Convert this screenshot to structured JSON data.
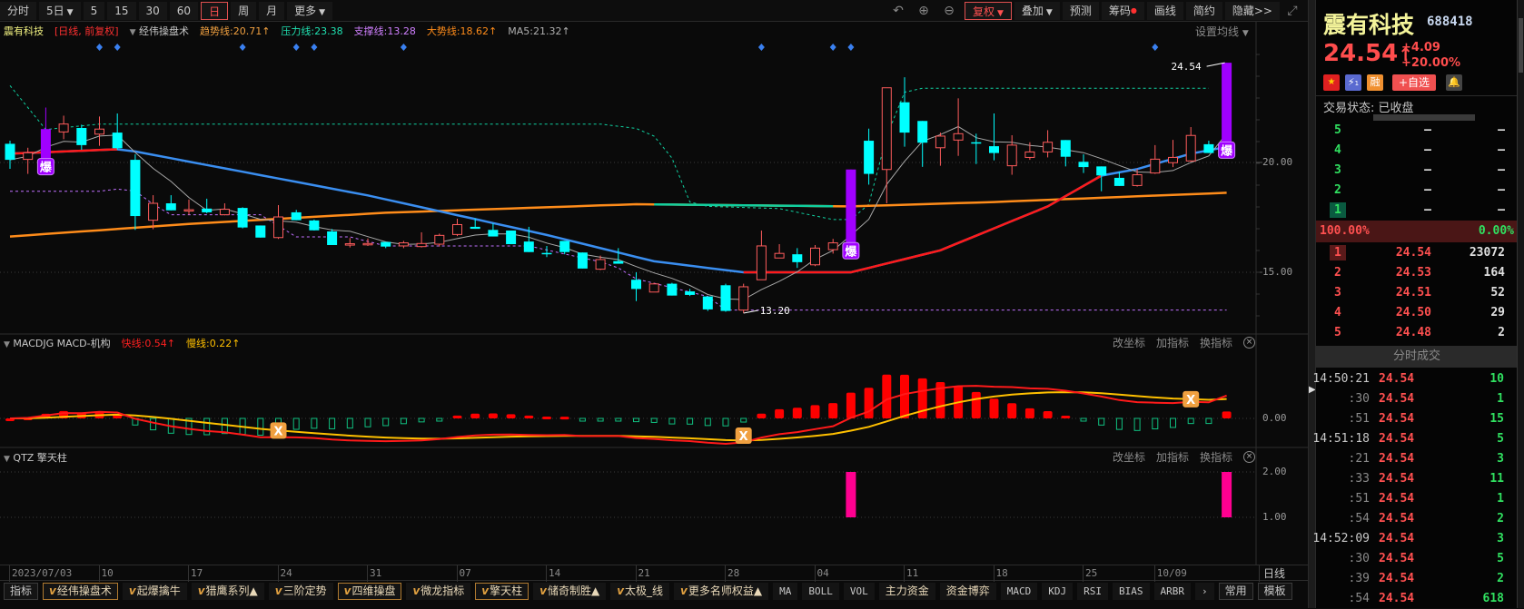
{
  "toolbar": {
    "left": [
      {
        "label": "分时"
      },
      {
        "label": "5日",
        "caret": true
      },
      {
        "label": "5"
      },
      {
        "label": "15"
      },
      {
        "label": "30"
      },
      {
        "label": "60"
      },
      {
        "label": "日",
        "selected": true
      },
      {
        "label": "周"
      },
      {
        "label": "月"
      },
      {
        "label": "更多",
        "caret": true
      }
    ],
    "icons": [
      "undo-icon",
      "zoom-in-icon",
      "zoom-out-icon"
    ],
    "icon_glyphs": [
      "↶",
      "⊕",
      "⊖"
    ],
    "right": [
      {
        "label": "复权",
        "caret": true,
        "selected": true
      },
      {
        "label": "叠加",
        "caret": true
      },
      {
        "label": "预测"
      },
      {
        "label": "筹码",
        "dot": true
      },
      {
        "label": "画线"
      },
      {
        "label": "简约"
      },
      {
        "label": "隐藏>>"
      }
    ],
    "fullscreen_glyph": "⤢"
  },
  "info": {
    "stock": "震有科技",
    "mode": "[日线, 前复权]",
    "indicator": "经伟操盘术",
    "trend": "趋势线:20.71↑",
    "pressure": "压力线:23.38",
    "support": "支撑线:13.28",
    "big_trend": "大势线:18.62↑",
    "ma5": "MA5:21.32↑",
    "set_ma": "设置均线"
  },
  "colors": {
    "up": "#ff5c5c",
    "down": "#00ffff",
    "explode": "#a000ff",
    "trend_up": "#ff1a1a",
    "trend_down": "#3a8ef0",
    "big_trend": "#ff8c1a",
    "big_trend_alt": "#10d0a0",
    "pressure": "#10d0a0",
    "support": "#c070ff",
    "ma5": "#a8a8a8",
    "diamond": "#3a80f0",
    "macd_fast": "#ff1a1a",
    "macd_slow": "#ffc000",
    "macd_pos": "#ff0000",
    "macd_neg": "#10c080",
    "qtz": "#ff0090"
  },
  "main_axis": {
    "ticks": [
      {
        "value": 20,
        "label": "20.00"
      },
      {
        "value": 15,
        "label": "15.00"
      }
    ]
  },
  "price_labels": {
    "high": "24.54",
    "low": "13.20",
    "explode": "爆"
  },
  "chart_data": {
    "type": "candlestick",
    "candles": [
      [
        20.85,
        20.99,
        19.71,
        20.12
      ],
      [
        20.14,
        20.67,
        19.48,
        20.44
      ],
      [
        20.1,
        22.5,
        20.0,
        21.52
      ],
      [
        21.39,
        22.13,
        21.06,
        21.75
      ],
      [
        21.57,
        21.72,
        20.58,
        20.79
      ],
      [
        21.29,
        22.09,
        20.76,
        21.52
      ],
      [
        21.36,
        22.23,
        20.58,
        20.65
      ],
      [
        20.12,
        20.37,
        16.93,
        17.56
      ],
      [
        17.37,
        18.51,
        16.96,
        18.14
      ],
      [
        18.14,
        18.51,
        17.82,
        17.82
      ],
      [
        17.8,
        18.31,
        17.62,
        17.85
      ],
      [
        17.9,
        18.35,
        17.69,
        17.73
      ],
      [
        17.62,
        18.14,
        17.59,
        17.87
      ],
      [
        17.93,
        17.96,
        17.0,
        17.04
      ],
      [
        17.13,
        17.13,
        16.58,
        16.58
      ],
      [
        16.58,
        18.06,
        16.52,
        17.52
      ],
      [
        17.73,
        17.84,
        17.37,
        17.37
      ],
      [
        17.36,
        17.4,
        16.9,
        16.91
      ],
      [
        16.86,
        16.97,
        16.24,
        16.24
      ],
      [
        16.26,
        16.56,
        16.13,
        16.3
      ],
      [
        16.27,
        16.54,
        16.2,
        16.31
      ],
      [
        16.38,
        16.38,
        16.1,
        16.17
      ],
      [
        16.2,
        16.43,
        16.1,
        16.34
      ],
      [
        16.17,
        16.82,
        16.13,
        16.31
      ],
      [
        16.28,
        16.76,
        16.17,
        16.68
      ],
      [
        16.72,
        17.44,
        16.65,
        17.17
      ],
      [
        17.07,
        17.45,
        16.98,
        16.98
      ],
      [
        16.93,
        17.23,
        16.63,
        16.63
      ],
      [
        16.9,
        16.9,
        16.28,
        16.28
      ],
      [
        16.4,
        17.07,
        15.92,
        15.92
      ],
      [
        15.88,
        16.2,
        15.69,
        15.84
      ],
      [
        16.43,
        16.43,
        15.82,
        15.92
      ],
      [
        15.9,
        15.9,
        15.17,
        15.17
      ],
      [
        15.14,
        15.76,
        15.1,
        15.58
      ],
      [
        15.51,
        16.1,
        15.39,
        15.39
      ],
      [
        14.66,
        15.0,
        13.69,
        14.24
      ],
      [
        14.1,
        14.52,
        14.1,
        14.47
      ],
      [
        14.48,
        14.52,
        13.94,
        13.94
      ],
      [
        14.13,
        14.24,
        13.92,
        13.97
      ],
      [
        13.9,
        13.9,
        13.24,
        13.31
      ],
      [
        14.41,
        14.48,
        13.2,
        13.24
      ],
      [
        13.28,
        14.48,
        13.14,
        14.34
      ],
      [
        14.66,
        16.9,
        14.66,
        16.2
      ],
      [
        15.65,
        16.28,
        15.65,
        15.86
      ],
      [
        15.82,
        16.1,
        15.2,
        15.46
      ],
      [
        15.34,
        16.24,
        15.28,
        16.1
      ],
      [
        16.03,
        16.52,
        15.85,
        16.34
      ],
      [
        16.27,
        19.68,
        16.2,
        19.68
      ],
      [
        20.99,
        21.54,
        18.99,
        19.48
      ],
      [
        19.68,
        23.4,
        18.14,
        23.4
      ],
      [
        22.74,
        23.88,
        20.72,
        21.36
      ],
      [
        21.89,
        21.89,
        19.8,
        20.9
      ],
      [
        20.67,
        21.36,
        19.85,
        21.2
      ],
      [
        21.02,
        22.92,
        20.3,
        21.31
      ],
      [
        20.92,
        21.31,
        19.93,
        20.88
      ],
      [
        20.74,
        22.23,
        20.1,
        20.43
      ],
      [
        19.85,
        21.24,
        19.44,
        20.79
      ],
      [
        20.23,
        20.92,
        20.12,
        20.48
      ],
      [
        20.48,
        21.47,
        20.23,
        20.92
      ],
      [
        21.02,
        21.02,
        19.82,
        20.26
      ],
      [
        20.03,
        20.37,
        19.52,
        19.79
      ],
      [
        19.82,
        19.82,
        18.69,
        19.41
      ],
      [
        19.3,
        19.57,
        18.93,
        18.93
      ],
      [
        18.95,
        19.71,
        18.9,
        19.44
      ],
      [
        19.52,
        20.79,
        19.48,
        20.15
      ],
      [
        19.99,
        21.03,
        19.79,
        20.23
      ],
      [
        20.07,
        21.61,
        20.03,
        21.23
      ],
      [
        20.83,
        20.99,
        20.43,
        20.43
      ],
      [
        20.85,
        24.54,
        20.45,
        24.54
      ]
    ],
    "explode_candles": [
      2,
      47,
      68
    ],
    "diamond_signals": [
      5,
      6,
      13,
      16,
      17,
      22,
      42,
      46,
      47,
      64
    ],
    "trend_line": [
      [
        0,
        20.4
      ],
      [
        6,
        20.6
      ],
      [
        7,
        20.5
      ],
      [
        20,
        18.5
      ],
      [
        30,
        16.7
      ],
      [
        36,
        15.5
      ],
      [
        41,
        15.0
      ],
      [
        47,
        15.0
      ],
      [
        52,
        16.0
      ],
      [
        58,
        18.0
      ],
      [
        61,
        19.4
      ],
      [
        63,
        19.7
      ],
      [
        66,
        20.4
      ],
      [
        68,
        20.71
      ]
    ],
    "trend_up_ranges": [
      [
        0,
        6
      ],
      [
        41,
        61
      ]
    ],
    "big_trend_line": [
      [
        0,
        16.63
      ],
      [
        10,
        17.2
      ],
      [
        21,
        17.71
      ],
      [
        35,
        18.1
      ],
      [
        47,
        18.0
      ],
      [
        55,
        18.2
      ],
      [
        68,
        18.62
      ]
    ],
    "big_trend_alt_range": [
      36,
      46
    ],
    "pressure_line": [
      [
        0,
        23.5
      ],
      [
        2,
        21.5
      ],
      [
        5,
        21.75
      ],
      [
        33,
        21.75
      ],
      [
        35,
        21.55
      ],
      [
        36,
        21.2
      ],
      [
        37,
        20.2
      ],
      [
        38,
        18.2
      ],
      [
        39,
        18.0
      ],
      [
        43,
        17.9
      ],
      [
        46,
        17.4
      ],
      [
        47,
        17.4
      ],
      [
        48,
        18.1
      ],
      [
        49,
        21.2
      ],
      [
        50,
        23.2
      ],
      [
        51,
        23.38
      ],
      [
        67,
        23.38
      ]
    ],
    "support_line": [
      [
        0,
        18.69
      ],
      [
        5,
        18.69
      ],
      [
        6,
        18.79
      ],
      [
        7,
        18.7
      ],
      [
        8,
        18.1
      ],
      [
        9,
        17.62
      ],
      [
        14,
        17.62
      ],
      [
        16,
        16.61
      ],
      [
        19,
        16.61
      ],
      [
        21,
        16.2
      ],
      [
        29,
        16.2
      ],
      [
        31,
        15.83
      ],
      [
        33,
        15.48
      ],
      [
        34,
        15.2
      ],
      [
        35,
        14.7
      ],
      [
        39,
        13.9
      ],
      [
        40,
        13.28
      ],
      [
        68,
        13.28
      ]
    ],
    "macd_cross_marks": [
      15,
      41,
      66
    ],
    "qtz_signals": [
      {
        "index": 47,
        "value": 2
      },
      {
        "index": 68,
        "value": 2
      }
    ],
    "qtz_range": [
      1,
      2
    ],
    "dates": [
      {
        "index": 0,
        "label": "2023/07/03"
      },
      {
        "index": 5,
        "label": "10"
      },
      {
        "index": 10,
        "label": "17"
      },
      {
        "index": 15,
        "label": "24"
      },
      {
        "index": 20,
        "label": "31"
      },
      {
        "index": 25,
        "label": "07"
      },
      {
        "index": 30,
        "label": "14"
      },
      {
        "index": 35,
        "label": "21"
      },
      {
        "index": 40,
        "label": "28"
      },
      {
        "index": 45,
        "label": "04"
      },
      {
        "index": 50,
        "label": "11"
      },
      {
        "index": 55,
        "label": "18"
      },
      {
        "index": 60,
        "label": "25"
      },
      {
        "index": 64,
        "label": "10/09"
      }
    ],
    "period_label": "日线"
  },
  "macd": {
    "name": "MACDJG MACD-机构",
    "fast": "快线:0.54↑",
    "slow": "慢线:0.22↑",
    "zero_label": "0.00",
    "cross_glyph": "X"
  },
  "qtz": {
    "name": "QTZ 擎天柱",
    "tick_hi": "2.00",
    "tick_lo": "1.00"
  },
  "pane_actions": [
    "改坐标",
    "加指标",
    "换指标"
  ],
  "close_glyph": "×",
  "collapse_glyph": "▼",
  "bottom_tabs": [
    {
      "label": "指标",
      "style": "gray"
    },
    {
      "label": "经伟操盘术",
      "v": true,
      "style": "b"
    },
    {
      "label": "起爆擒牛",
      "v": true
    },
    {
      "label": "猎鹰系列▲",
      "v": true
    },
    {
      "label": "三阶定势",
      "v": true
    },
    {
      "label": "四维操盘",
      "v": true,
      "style": "b"
    },
    {
      "label": "微龙指标",
      "v": true
    },
    {
      "label": "擎天柱",
      "v": true,
      "style": "b"
    },
    {
      "label": "储奇制胜▲",
      "v": true
    },
    {
      "label": "太极_线",
      "v": true
    },
    {
      "label": "更多名师权益▲",
      "v": true
    },
    {
      "label": "MA",
      "style": "plain"
    },
    {
      "label": "BOLL",
      "style": "plain"
    },
    {
      "label": "VOL",
      "style": "plain"
    },
    {
      "label": "主力资金"
    },
    {
      "label": "资金博弈"
    },
    {
      "label": "MACD",
      "style": "plain"
    },
    {
      "label": "KDJ",
      "style": "plain"
    },
    {
      "label": "RSI",
      "style": "plain"
    },
    {
      "label": "BIAS",
      "style": "plain"
    },
    {
      "label": "ARBR",
      "style": "plain"
    },
    {
      "label": "›",
      "style": "plain"
    },
    {
      "label": "常用",
      "style": "gray"
    },
    {
      "label": "模板",
      "style": "gray"
    }
  ],
  "tab_v_glyph": "v",
  "quote": {
    "name": "震有科技",
    "code": "688418",
    "price": "24.54",
    "arrow": "↑",
    "change": "+4.09",
    "pct": "+20.00%",
    "badge_margin": "融",
    "badge_flash": "1",
    "watch_button": "+自选",
    "status": "交易状态: 已收盘",
    "sell": [
      {
        "n": "5",
        "p": "—",
        "v": "—"
      },
      {
        "n": "4",
        "p": "—",
        "v": "—"
      },
      {
        "n": "3",
        "p": "—",
        "v": "—"
      },
      {
        "n": "2",
        "p": "—",
        "v": "—"
      },
      {
        "n": "1",
        "p": "—",
        "v": "—"
      }
    ],
    "ratio_buy": "100.00%",
    "ratio_sell": "0.00%",
    "buy": [
      {
        "n": "1",
        "p": "24.54",
        "v": "23072"
      },
      {
        "n": "2",
        "p": "24.53",
        "v": "164"
      },
      {
        "n": "3",
        "p": "24.51",
        "v": "52"
      },
      {
        "n": "4",
        "p": "24.50",
        "v": "29"
      },
      {
        "n": "5",
        "p": "24.48",
        "v": "2"
      }
    ],
    "trades_title": "分时成交",
    "trades": [
      {
        "t": "14:50:21",
        "p": "24.54",
        "v": "10"
      },
      {
        "t": ":30",
        "p": "24.54",
        "v": "1"
      },
      {
        "t": ":51",
        "p": "24.54",
        "v": "15"
      },
      {
        "t": "14:51:18",
        "p": "24.54",
        "v": "5"
      },
      {
        "t": ":21",
        "p": "24.54",
        "v": "3"
      },
      {
        "t": ":33",
        "p": "24.54",
        "v": "11"
      },
      {
        "t": ":51",
        "p": "24.54",
        "v": "1"
      },
      {
        "t": ":54",
        "p": "24.54",
        "v": "2"
      },
      {
        "t": "14:52:09",
        "p": "24.54",
        "v": "3"
      },
      {
        "t": ":30",
        "p": "24.54",
        "v": "5"
      },
      {
        "t": ":39",
        "p": "24.54",
        "v": "2"
      },
      {
        "t": ":54",
        "p": "24.54",
        "v": "618"
      }
    ]
  }
}
